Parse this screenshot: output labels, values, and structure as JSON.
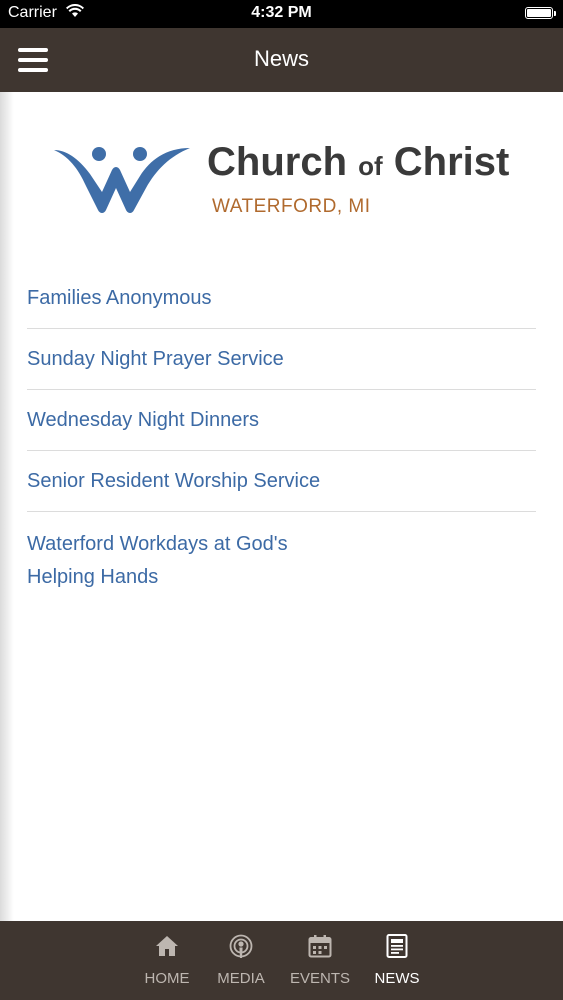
{
  "status_bar": {
    "carrier": "Carrier",
    "time": "4:32 PM"
  },
  "header": {
    "title": "News",
    "menu_icon": "hamburger-menu-icon"
  },
  "logo": {
    "name_part1": "Church ",
    "name_of": "of",
    "name_part2": " Christ",
    "location": "WATERFORD, MI",
    "colors": {
      "mark": "#3f6ea8",
      "name": "#3a3a3a",
      "location": "#b06a2e"
    }
  },
  "news": {
    "items": [
      "Families Anonymous",
      "Sunday Night Prayer Service",
      "Wednesday Night Dinners",
      "Senior Resident Worship Service",
      "Waterford Workdays at God's Helping Hands"
    ]
  },
  "tabbar": {
    "tabs": [
      {
        "label": "HOME",
        "icon": "home-icon",
        "active": false
      },
      {
        "label": "MEDIA",
        "icon": "podcast-icon",
        "active": false
      },
      {
        "label": "EVENTS",
        "icon": "calendar-icon",
        "active": false
      },
      {
        "label": "NEWS",
        "icon": "newspaper-icon",
        "active": true
      }
    ]
  },
  "colors": {
    "nav_background": "#3f3630",
    "link": "#3c6aa5"
  }
}
